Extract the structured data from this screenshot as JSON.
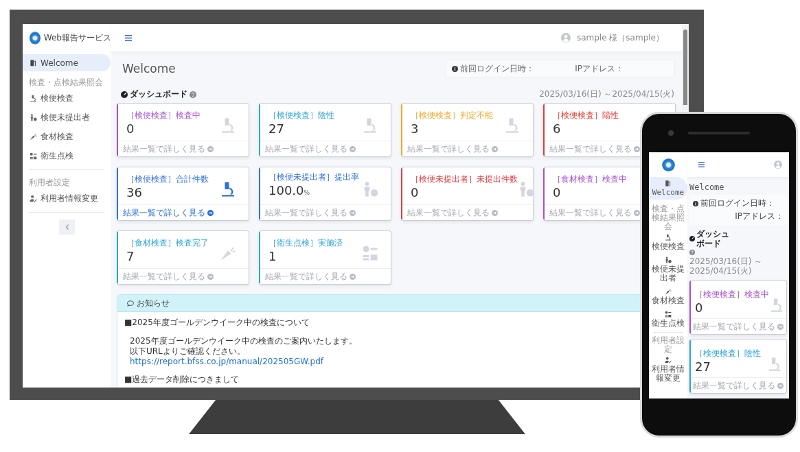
{
  "desktop": {
    "header": {
      "app_name": "Web報告サービス",
      "user": "sample 様（sample）"
    },
    "sidebar": {
      "items": [
        {
          "kind": "welcome",
          "label": "Welcome",
          "selected": true
        },
        {
          "kind": "heading",
          "label": "検査・点検結果照会"
        },
        {
          "kind": "stool",
          "label": "検便検査",
          "selected": false
        },
        {
          "kind": "unsubmitted",
          "label": "検便未提出者",
          "selected": false
        },
        {
          "kind": "food",
          "label": "食材検査",
          "selected": false
        },
        {
          "kind": "hygiene",
          "label": "衛生点検",
          "selected": false
        },
        {
          "kind": "heading",
          "label": "利用者設定"
        },
        {
          "kind": "account",
          "label": "利用者情報変更",
          "selected": false
        }
      ]
    },
    "page_title": "Welcome",
    "login_info": {
      "last_login_label": "前回ログイン日時：",
      "ip_label": "IPアドレス："
    },
    "dashboard": {
      "title": "ダッシュボード",
      "period": "2025/03/16(日) ～2025/04/15(火)",
      "cards": [
        {
          "kind": "stool",
          "category": "［検便検査］",
          "label": "検査中",
          "value": "0",
          "color": "#a550cf",
          "highlighted": false,
          "link": "結果一覧で詳しく見る"
        },
        {
          "kind": "stool",
          "category": "［検便検査］",
          "label": "陰性",
          "value": "27",
          "color": "#2ba5d8",
          "highlighted": false,
          "link": "結果一覧で詳しく見る"
        },
        {
          "kind": "stool",
          "category": "［検便検査］",
          "label": "判定不能",
          "value": "3",
          "color": "#f4a62a",
          "highlighted": false,
          "link": "結果一覧で詳しく見る"
        },
        {
          "kind": "stool",
          "category": "［検便検査］",
          "label": "陽性",
          "value": "6",
          "color": "#e8382f",
          "highlighted": false,
          "link": "結果一覧で詳しく見る"
        },
        {
          "kind": "stool",
          "category": "［検便検査］",
          "label": "合計件数",
          "value": "36",
          "color": "#2f6fe0",
          "highlighted": true,
          "link": "結果一覧で詳しく見る"
        },
        {
          "kind": "unsubmitted",
          "category": "［検便未提出者］",
          "label": "提出率",
          "value": "100.0",
          "unit": "%",
          "color": "#2f6fe0",
          "highlighted": false,
          "link": "結果一覧で詳しく見る"
        },
        {
          "kind": "unsubmitted",
          "category": "［検便未提出者］",
          "label": "未提出件数",
          "value": "0",
          "color": "#e8383e",
          "highlighted": false,
          "link": "結果一覧で詳しく見る"
        },
        {
          "kind": "food",
          "category": "［食材検査］",
          "label": "検査中",
          "value": "0",
          "color": "#a550cf",
          "highlighted": false,
          "link": "結果一覧で詳しく見る"
        },
        {
          "kind": "food",
          "category": "［食材検査］",
          "label": "検査完了",
          "value": "7",
          "color": "#2ba5d8",
          "highlighted": false,
          "link": "結果一覧で詳しく見る"
        },
        {
          "kind": "hygiene",
          "category": "［衛生点検］",
          "label": "実施済",
          "value": "1",
          "color": "#2ba5d8",
          "highlighted": false,
          "link": "結果一覧で詳しく見る"
        }
      ]
    },
    "notice": {
      "title": "お知らせ",
      "lines": [
        {
          "kind": "heading",
          "text": "■2025年度ゴールデンウイーク中の検査について"
        },
        {
          "kind": "body",
          "text": "2025年度ゴールデンウイーク中の検査のご案内いたします。"
        },
        {
          "kind": "body",
          "text": "以下URLよりご確認ください。"
        },
        {
          "kind": "link",
          "text": "https://report.bfss.co.jp/manual/202505GW.pdf"
        },
        {
          "kind": "heading",
          "text": "■過去データ削除につきまして"
        }
      ]
    }
  },
  "phone": {
    "sidebar": {
      "items": [
        {
          "kind": "welcome",
          "label": "Welcome",
          "selected": true
        },
        {
          "kind": "heading",
          "label": "検査・点検結果照会"
        },
        {
          "kind": "stool",
          "label": "検便検査",
          "selected": false
        },
        {
          "kind": "unsubmitted",
          "label": "検便未提出者",
          "selected": false
        },
        {
          "kind": "food",
          "label": "食材検査",
          "selected": false
        },
        {
          "kind": "hygiene",
          "label": "衛生点検",
          "selected": false
        },
        {
          "kind": "heading",
          "label": "利用者設定"
        },
        {
          "kind": "account",
          "label": "利用者情報変更",
          "selected": false
        }
      ]
    },
    "page_title": "Welcome",
    "login_info": {
      "last_login_label": "前回ログイン日時：",
      "ip_label": "IPアドレス："
    },
    "dashboard": {
      "title": "ダッシュボード",
      "period": "2025/03/16(日) ～ 2025/04/15(火)",
      "cards": [
        {
          "kind": "stool",
          "category": "［検便検査］",
          "label": "検査中",
          "value": "0",
          "color": "#a550cf",
          "highlighted": false,
          "link": "結果一覧で詳しく見る"
        },
        {
          "kind": "stool",
          "category": "［検便検査］",
          "label": "陰性",
          "value": "27",
          "color": "#2ba5d8",
          "highlighted": false,
          "link": "結果一覧で詳しく見る"
        }
      ]
    }
  }
}
